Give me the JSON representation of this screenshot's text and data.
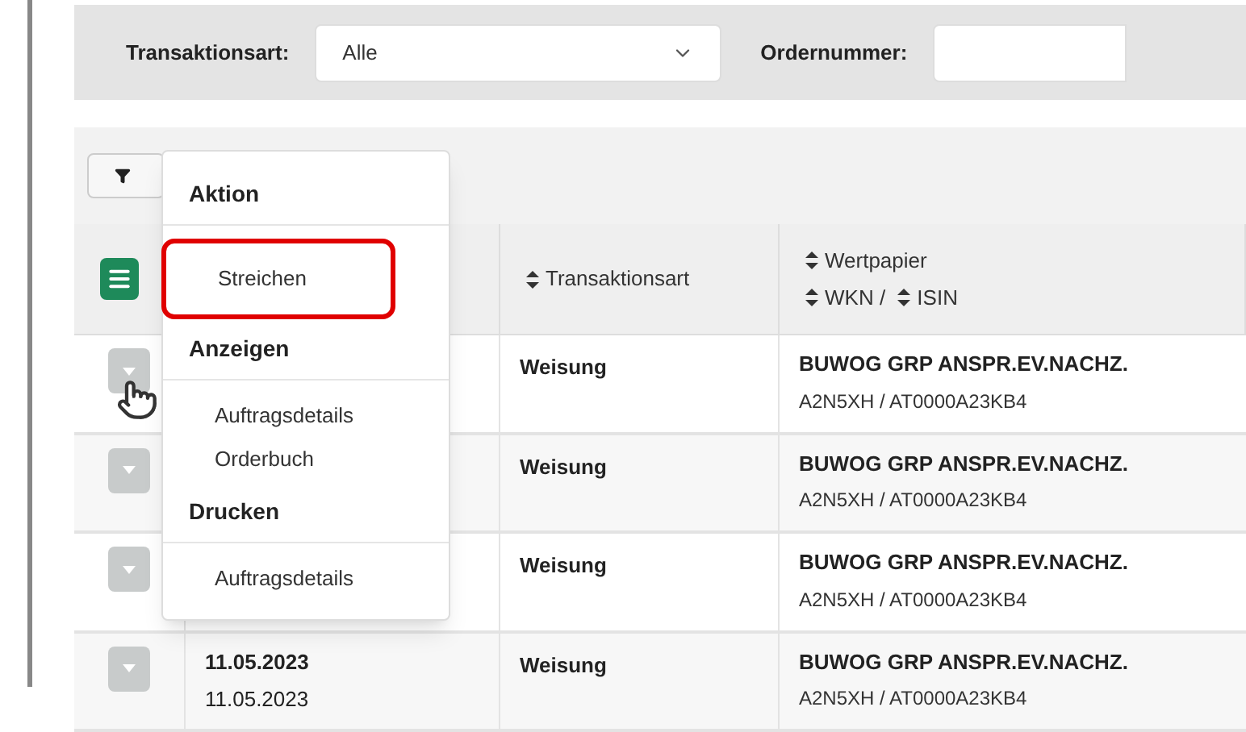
{
  "filters": [
    {
      "label": "Transaktionsart:",
      "kind": "select",
      "value": "Alle"
    },
    {
      "label": "Ordernummer:",
      "kind": "text"
    }
  ],
  "table": {
    "columns": [
      {
        "kind": "menu"
      },
      {
        "kind": "hidden"
      },
      {
        "kind": "sort",
        "labels": [
          "Transaktionsart"
        ]
      },
      {
        "kind": "sort",
        "labels": [
          "Wertpapier",
          "WKN / ",
          "ISIN"
        ]
      }
    ],
    "rows": [
      {
        "dates": [],
        "type": "Weisung",
        "security": "BUWOG GRP ANSPR.EV.NACHZ.",
        "codes": "A2N5XH / AT0000A23KB4"
      },
      {
        "dates": [],
        "type": "Weisung",
        "security": "BUWOG GRP ANSPR.EV.NACHZ.",
        "codes": "A2N5XH / AT0000A23KB4"
      },
      {
        "dates": [],
        "type": "Weisung",
        "security": "BUWOG GRP ANSPR.EV.NACHZ.",
        "codes": "A2N5XH / AT0000A23KB4"
      },
      {
        "dates": [
          "11.05.2023",
          "11.05.2023"
        ],
        "type": "Weisung",
        "security": "BUWOG GRP ANSPR.EV.NACHZ.",
        "codes": "A2N5XH / AT0000A23KB4"
      }
    ]
  },
  "menu": {
    "sections": [
      {
        "heading": "Aktion",
        "items": [
          {
            "label": "Streichen",
            "selected": true
          }
        ]
      },
      {
        "heading": "Anzeigen",
        "items": [
          {
            "label": "Auftragsdetails",
            "selected": false
          },
          {
            "label": "Orderbuch",
            "selected": false
          }
        ]
      },
      {
        "heading": "Drucken",
        "items": [
          {
            "label": "Auftragsdetails",
            "selected": false
          }
        ]
      }
    ]
  }
}
